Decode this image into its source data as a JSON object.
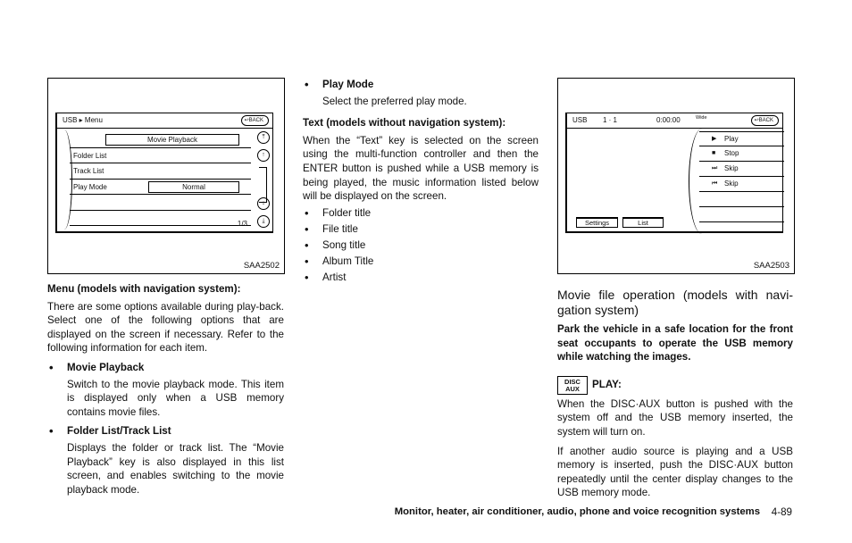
{
  "figures": {
    "menu_screen": {
      "code": "SAA2502",
      "title": "USB ▸ Menu",
      "back_label": "BACK",
      "rows": [
        {
          "label": "Movie Playback",
          "value": ""
        },
        {
          "label": "Folder List",
          "value": ""
        },
        {
          "label": "Track List",
          "value": ""
        },
        {
          "label": "Play Mode",
          "value": "Normal"
        },
        {
          "label": "",
          "value": ""
        },
        {
          "label": "",
          "value": ""
        }
      ],
      "page_indicator": "1/3",
      "side_icons": [
        "scroll-top-icon",
        "scroll-up-icon",
        "scroll-down-icon",
        "scroll-bottom-icon"
      ]
    },
    "movie_screen": {
      "code": "SAA2503",
      "source": "USB",
      "track": "1 · 1",
      "time": "0:00:00",
      "aspect": "Wide",
      "back_label": "BACK",
      "controls": [
        {
          "icon": "play-icon",
          "glyph": "▶",
          "label": "Play"
        },
        {
          "icon": "stop-icon",
          "glyph": "■",
          "label": "Stop"
        },
        {
          "icon": "skip-forward-icon",
          "glyph": "⏭",
          "label": "Skip"
        },
        {
          "icon": "skip-back-icon",
          "glyph": "⏮",
          "label": "Skip"
        }
      ],
      "buttons": [
        "Settings",
        "List"
      ]
    }
  },
  "col1": {
    "heading": "Menu (models with navigation system):",
    "intro": "There are some options available during play-back. Select one of the following options that are displayed on the screen if necessary. Refer to the following information for each item.",
    "bullets": [
      {
        "title": "Movie Playback",
        "body": "Switch to the movie playback mode. This item is displayed only when a USB memory contains movie files."
      },
      {
        "title": "Folder List/Track List",
        "body": "Displays the folder or track list. The “Movie Playback” key is also displayed in this list screen, and enables switching to the movie playback mode."
      }
    ]
  },
  "col2": {
    "bullet": {
      "title": "Play Mode",
      "body": "Select the preferred play mode."
    },
    "heading": "Text (models without navigation system):",
    "intro": "When the “Text” key is selected on the screen using the multi-function controller and then the ENTER button is pushed while a USB memory is being played, the music information listed below will be displayed on the screen.",
    "list": [
      "Folder title",
      "File title",
      "Song title",
      "Album Title",
      "Artist"
    ]
  },
  "col3": {
    "section_title": "Movie file operation (models with navi-gation system)",
    "warning": "Park the vehicle in a safe location for the front seat occupants to operate the USB memory while watching the images.",
    "disc_aux_line1": "DISC",
    "disc_aux_line2": "AUX",
    "play_heading": "PLAY:",
    "para1": "When the DISC·AUX button is pushed with the system off and the USB memory inserted, the system will turn on.",
    "para2": "If another audio source is playing and a USB memory is inserted, push the DISC·AUX button repeatedly until the center display changes to the USB memory mode."
  },
  "footer": {
    "section": "Monitor, heater, air conditioner, audio, phone and voice recognition systems",
    "page": "4-89"
  }
}
